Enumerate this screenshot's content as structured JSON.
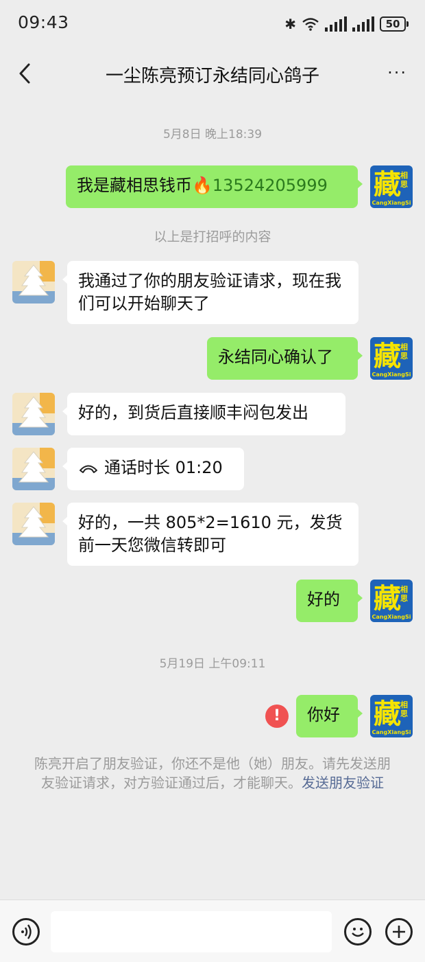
{
  "status_bar": {
    "time": "09:43",
    "battery": "50"
  },
  "header": {
    "title": "一尘陈亮预订永结同心鸽子",
    "more": "···"
  },
  "avatars": {
    "me_big": "藏",
    "me_small": "相思",
    "me_caption": "CangXiangSi"
  },
  "messages": {
    "ts1": "5月8日 晚上18:39",
    "m1_prefix": "我是藏相思钱币🔥",
    "m1_phone": "13524205999",
    "greeting_note": "以上是打招呼的内容",
    "m2": "我通过了你的朋友验证请求，现在我们可以开始聊天了",
    "m3": "永结同心确认了",
    "m4": "好的，到货后直接顺丰闷包发出",
    "m5_call": "通话时长 01:20",
    "m6": "好的，一共 805*2=1610 元，发货前一天您微信转即可",
    "m7": "好的",
    "ts2": "5月19日 上午09:11",
    "m8": "你好",
    "error_mark": "!"
  },
  "notice": {
    "text": "陈亮开启了朋友验证，你还不是他（她）朋友。请先发送朋友验证请求，对方验证通过后，才能聊天。",
    "link": "发送朋友验证"
  },
  "colors": {
    "bg": "#ededed",
    "out_bubble": "#95ec69",
    "in_bubble": "#ffffff",
    "link": "#576b95",
    "error": "#f05252"
  },
  "icons": [
    "bluetooth-icon",
    "wifi-icon",
    "signal-icon",
    "battery-icon",
    "back-icon",
    "more-icon",
    "voice-icon",
    "emoji-icon",
    "plus-icon",
    "phone-icon"
  ]
}
